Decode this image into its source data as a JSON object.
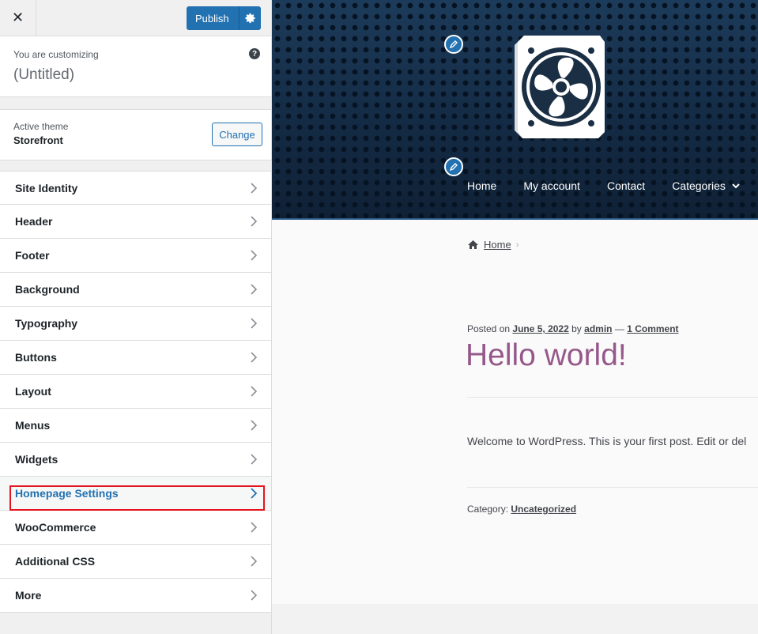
{
  "topbar": {
    "close_symbol": "✕",
    "publish_label": "Publish"
  },
  "customizing": {
    "label": "You are customizing",
    "site_title": "(Untitled)"
  },
  "theme": {
    "label": "Active theme",
    "name": "Storefront",
    "change_label": "Change"
  },
  "menu": {
    "items": [
      {
        "label": "Site Identity"
      },
      {
        "label": "Header"
      },
      {
        "label": "Footer"
      },
      {
        "label": "Background"
      },
      {
        "label": "Typography"
      },
      {
        "label": "Buttons"
      },
      {
        "label": "Layout"
      },
      {
        "label": "Menus"
      },
      {
        "label": "Widgets"
      },
      {
        "label": "Homepage Settings"
      },
      {
        "label": "WooCommerce"
      },
      {
        "label": "Additional CSS"
      },
      {
        "label": "More"
      }
    ],
    "highlighted": "Homepage Settings"
  },
  "preview": {
    "nav": [
      "Home",
      "My account",
      "Contact",
      "Categories"
    ],
    "breadcrumb_home": "Home",
    "post": {
      "posted_on": "Posted on",
      "date": "June 5, 2022",
      "by": "by",
      "author": "admin",
      "dash": "—",
      "comments": "1 Comment",
      "title": "Hello world!",
      "excerpt": "Welcome to WordPress. This is your first post. Edit or del",
      "category_label": "Category:",
      "category": "Uncategorized"
    }
  },
  "colors": {
    "accent": "#2271b1",
    "title_purple": "#96588a",
    "highlight_red": "#e3141e"
  },
  "icons": [
    "close-icon",
    "gear-icon",
    "help-icon",
    "chevron-right-icon",
    "pencil-icon",
    "fan-logo",
    "home-icon",
    "chevron-down-icon"
  ]
}
